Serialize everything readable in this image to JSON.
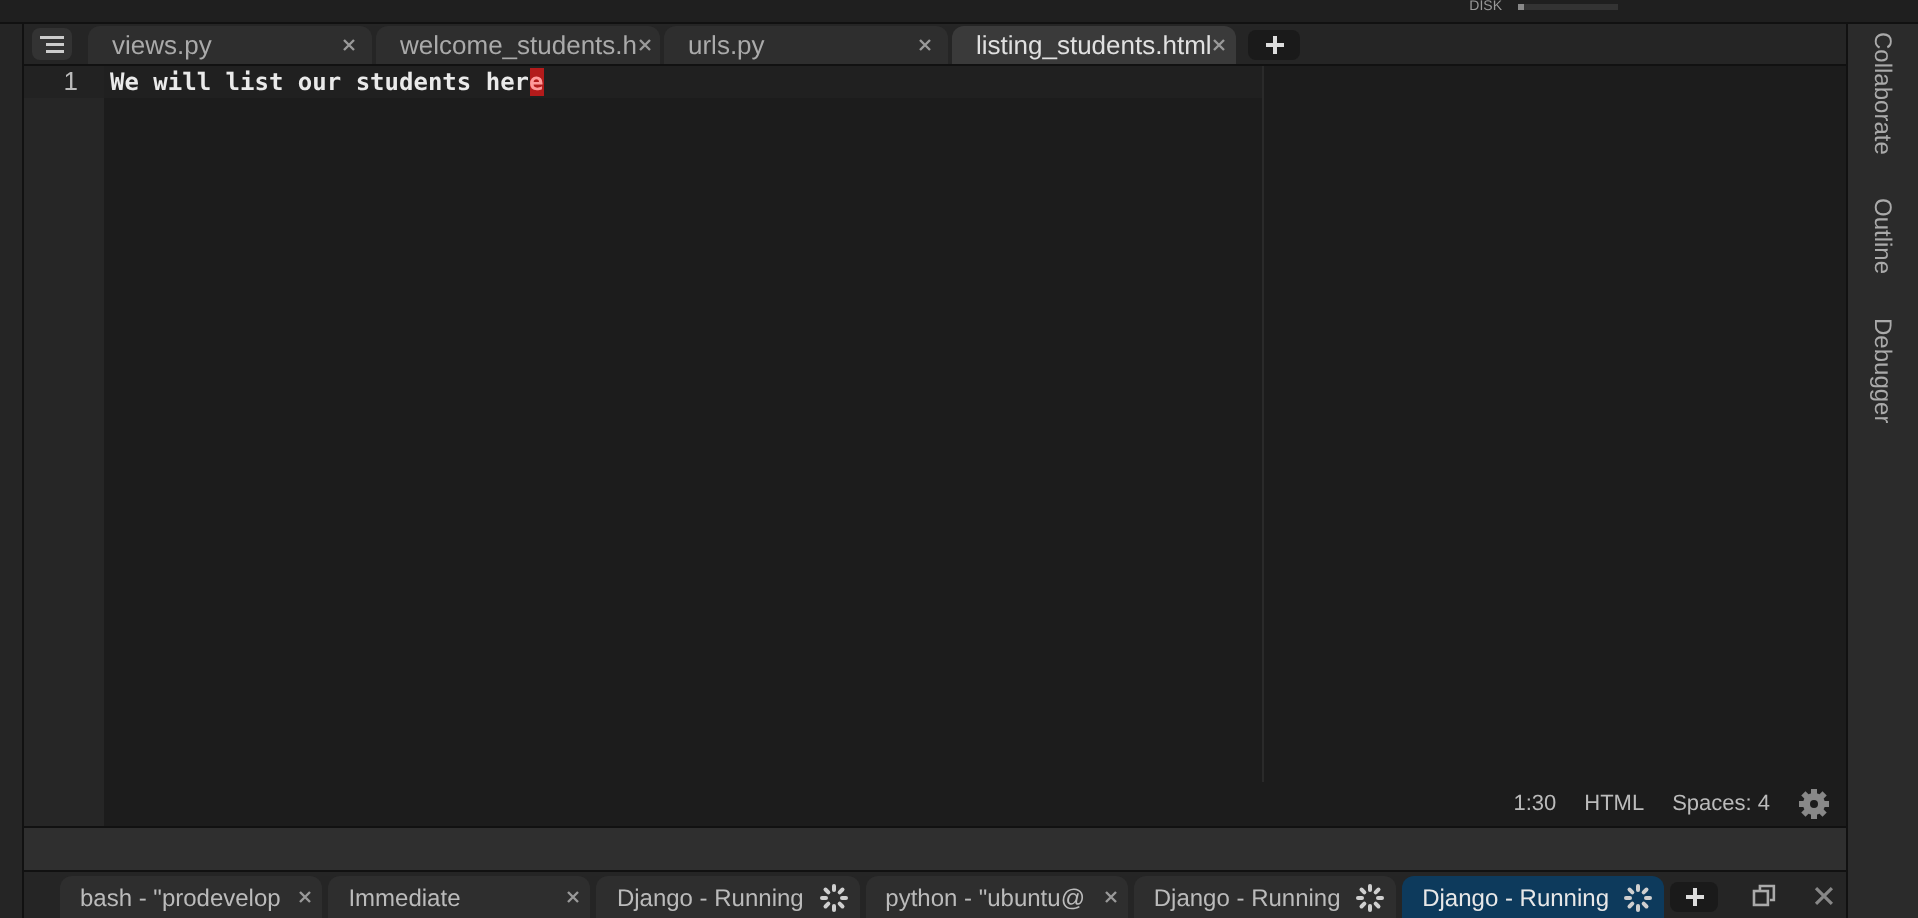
{
  "top_bar": {
    "disk_label": "DISK"
  },
  "editor_tabs": [
    {
      "label": "views.py",
      "selected": false
    },
    {
      "label": "welcome_students.h",
      "selected": false
    },
    {
      "label": "urls.py",
      "selected": false
    },
    {
      "label": "listing_students.html",
      "selected": true
    }
  ],
  "editor": {
    "lines": [
      {
        "number": "1",
        "text": "We will list our students her",
        "cursor_char": "e"
      }
    ]
  },
  "status": {
    "position": "1:30",
    "mode": "HTML",
    "indent": "Spaces: 4"
  },
  "right_sidebar": [
    "Collaborate",
    "Outline",
    "Debugger"
  ],
  "console_tabs": [
    {
      "label": "bash - \"prodevelop",
      "kind": "closable",
      "selected": false
    },
    {
      "label": "Immediate",
      "kind": "closable",
      "selected": false
    },
    {
      "label": "Django - Running",
      "kind": "running",
      "selected": false
    },
    {
      "label": "python - \"ubuntu@",
      "kind": "closable",
      "selected": false
    },
    {
      "label": "Django - Running",
      "kind": "running",
      "selected": false
    },
    {
      "label": "Django - Running",
      "kind": "running",
      "selected": true
    }
  ]
}
